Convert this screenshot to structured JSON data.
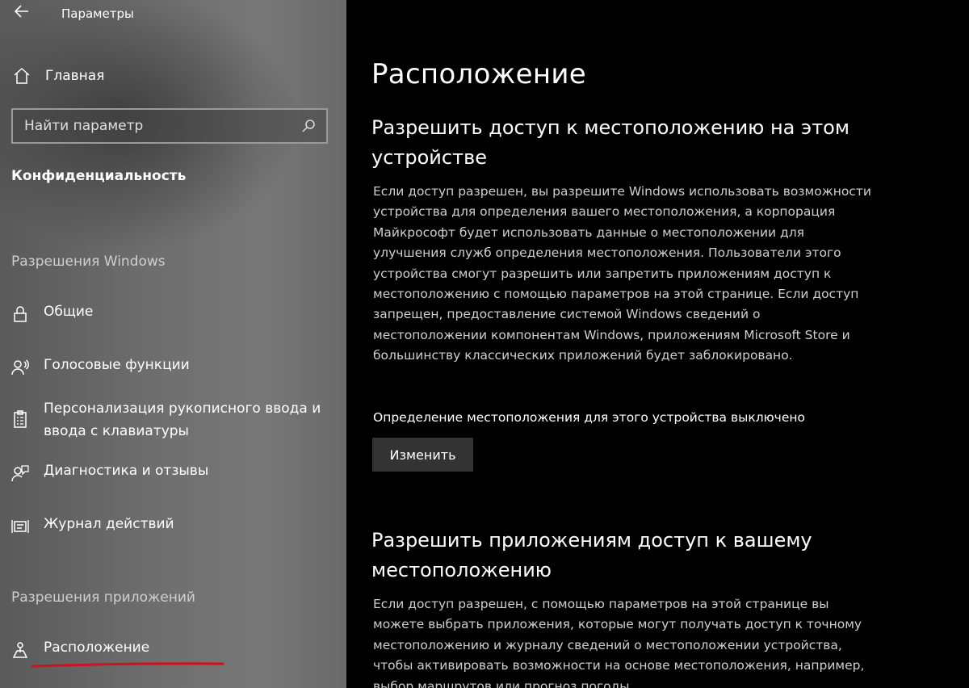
{
  "window": {
    "title": "Параметры"
  },
  "sidebar": {
    "home_label": "Главная",
    "search_placeholder": "Найти параметр",
    "section_title": "Конфиденциальность",
    "group_windows": "Разрешения Windows",
    "group_apps": "Разрешения приложений",
    "items": [
      {
        "label": "Общие",
        "icon": "lock-icon"
      },
      {
        "label": "Голосовые функции",
        "icon": "speech-icon"
      },
      {
        "label": "Персонализация рукописного ввода и ввода с клавиатуры",
        "icon": "clipboard-icon"
      },
      {
        "label": "Диагностика и отзывы",
        "icon": "feedback-icon"
      },
      {
        "label": "Журнал действий",
        "icon": "activity-history-icon"
      },
      {
        "label": "Расположение",
        "icon": "location-icon"
      }
    ],
    "annotation_color": "#d0101a"
  },
  "main": {
    "page_title": "Расположение",
    "section1": {
      "heading": "Разрешить доступ к местоположению на этом устройстве",
      "description": "Если доступ разрешен, вы разрешите Windows использовать возможности устройства для определения вашего местоположения, а корпорация Майкрософт будет использовать данные о местоположении для улучшения служб определения местоположения. Пользователи этого устройства смогут разрешить или запретить приложениям доступ к местоположению с помощью параметров на этой странице. Если доступ запрещен, предоставление системой Windows сведений о местоположении компонентам Windows, приложениям Microsoft Store и большинству классических приложений будет заблокировано.",
      "status": "Определение местоположения для этого устройства выключено",
      "button_label": "Изменить"
    },
    "section2": {
      "heading": "Разрешить приложениям доступ к вашему местоположению",
      "description": "Если доступ разрешен, с помощью параметров на этой странице вы можете выбрать приложения, которые могут получать доступ к точному местоположению и журналу сведений о местоположении устройства, чтобы активировать возможности на основе местоположения, например, выбор маршрутов или прогноз погоды."
    }
  },
  "colors": {
    "sidebar_bg": "#6e6e6e",
    "main_bg": "#000000",
    "button_bg": "#333333",
    "description_text": "#cfcfcf"
  }
}
